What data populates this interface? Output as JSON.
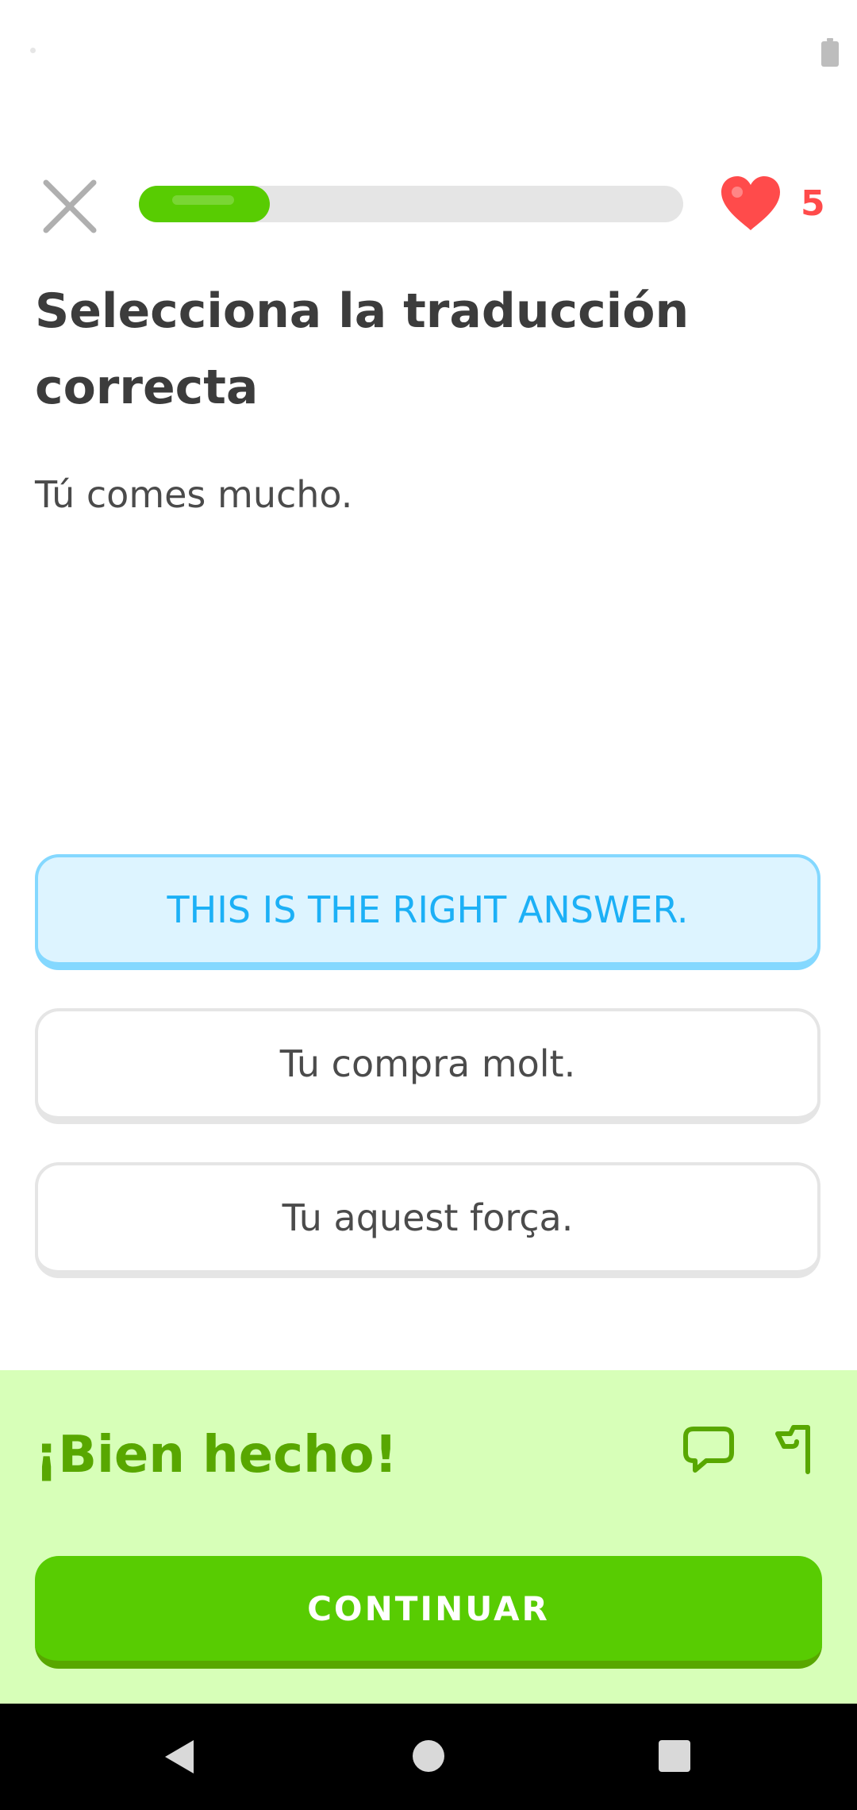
{
  "header": {
    "progress_fraction": 0.24,
    "hearts_count": "5"
  },
  "challenge": {
    "title": "Selecciona la traducción correcta",
    "prompt": "Tú comes mucho."
  },
  "options": [
    {
      "label": "THIS IS THE RIGHT ANSWER.",
      "selected": true
    },
    {
      "label": "Tu compra molt.",
      "selected": false
    },
    {
      "label": "Tu aquest força.",
      "selected": false
    }
  ],
  "feedback": {
    "title": "¡Bien hecho!",
    "continue_label": "CONTINUAR"
  },
  "colors": {
    "accent_green": "#58cc02",
    "feedback_bg": "#d7ffb8",
    "feedback_text": "#58a700",
    "selected_blue": "#1cb0f6",
    "heart_red": "#ff4b4b"
  },
  "icons": {
    "close": "close-icon",
    "heart": "heart-icon",
    "discuss": "comment-icon",
    "report": "flag-icon",
    "battery": "battery-icon"
  }
}
